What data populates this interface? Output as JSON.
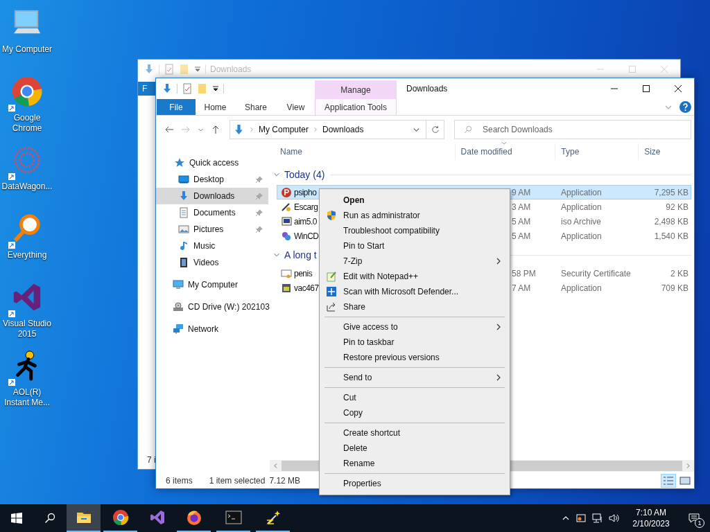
{
  "desktop_icons": [
    {
      "label": "My Computer",
      "shortcut": false
    },
    {
      "label": "Google Chrome",
      "shortcut": true
    },
    {
      "label": "DataWagon...",
      "shortcut": true
    },
    {
      "label": "Everything",
      "shortcut": true
    },
    {
      "label": "Visual Studio 2015",
      "shortcut": true
    },
    {
      "label": "AOL(R) Instant Me...",
      "shortcut": true
    }
  ],
  "back_window": {
    "title": "Downloads",
    "file_tab": "F",
    "status": "7 i"
  },
  "window": {
    "title": "Downloads",
    "context_tab": "Manage",
    "tabs": [
      {
        "label": "File",
        "kind": "file"
      },
      {
        "label": "Home",
        "kind": "tab"
      },
      {
        "label": "Share",
        "kind": "tab"
      },
      {
        "label": "View",
        "kind": "tab"
      },
      {
        "label": "Application Tools",
        "kind": "context"
      }
    ],
    "address": [
      "My Computer",
      "Downloads"
    ],
    "search": {
      "placeholder": "Search Downloads"
    },
    "nav": [
      {
        "label": "Quick access",
        "selected": false,
        "pinned": false,
        "children": [
          {
            "label": "Desktop",
            "selected": false,
            "pinned": true
          },
          {
            "label": "Downloads",
            "selected": true,
            "pinned": true
          },
          {
            "label": "Documents",
            "selected": false,
            "pinned": true
          },
          {
            "label": "Pictures",
            "selected": false,
            "pinned": true
          },
          {
            "label": "Music",
            "selected": false,
            "pinned": false
          },
          {
            "label": "Videos",
            "selected": false,
            "pinned": false
          }
        ]
      },
      {
        "label": "My Computer",
        "selected": false,
        "pinned": false
      },
      {
        "label": "CD Drive (W:) 202103",
        "selected": false,
        "pinned": false
      },
      {
        "label": "Network",
        "selected": false,
        "pinned": false
      }
    ],
    "columns": [
      {
        "label": "Name",
        "sorted": false
      },
      {
        "label": "Date modified",
        "sorted": true
      },
      {
        "label": "Type",
        "sorted": false
      },
      {
        "label": "Size",
        "sorted": false
      }
    ],
    "groups": [
      {
        "title": "Today (4)",
        "rows": [
          {
            "name": "psipho",
            "date": "9 AM",
            "type": "Application",
            "size": "7,295 KB",
            "selected": true
          },
          {
            "name": "Escarg",
            "date": "3 AM",
            "type": "Application",
            "size": "92 KB",
            "selected": false
          },
          {
            "name": "aim5.0",
            "date": "5 AM",
            "type": "iso Archive",
            "size": "2,498 KB",
            "selected": false
          },
          {
            "name": "WinCD",
            "date": "5 AM",
            "type": "Application",
            "size": "1,540 KB",
            "selected": false
          }
        ]
      },
      {
        "title": "A long t",
        "rows": [
          {
            "name": "penis",
            "date": "58 PM",
            "type": "Security Certificate",
            "size": "2 KB",
            "selected": false
          },
          {
            "name": "vac467",
            "date": "7 AM",
            "type": "Application",
            "size": "709 KB",
            "selected": false
          }
        ]
      }
    ],
    "status": {
      "items": "6 items",
      "selection": "1 item selected",
      "size": "7.12 MB"
    },
    "views": [
      {
        "kind": "details",
        "selected": true
      },
      {
        "kind": "large",
        "selected": false
      }
    ]
  },
  "context_menu": [
    {
      "kind": "item",
      "label": "Open",
      "default": true,
      "submenu": false
    },
    {
      "kind": "item",
      "label": "Run as administrator",
      "default": false,
      "submenu": false
    },
    {
      "kind": "item",
      "label": "Troubleshoot compatibility",
      "default": false,
      "submenu": false
    },
    {
      "kind": "item",
      "label": "Pin to Start",
      "default": false,
      "submenu": false
    },
    {
      "kind": "item",
      "label": "7-Zip",
      "default": false,
      "submenu": true
    },
    {
      "kind": "item",
      "label": "Edit with Notepad++",
      "default": false,
      "submenu": false
    },
    {
      "kind": "item",
      "label": "Scan with Microsoft Defender...",
      "default": false,
      "submenu": false
    },
    {
      "kind": "item",
      "label": "Share",
      "default": false,
      "submenu": false
    },
    {
      "kind": "separator"
    },
    {
      "kind": "item",
      "label": "Give access to",
      "default": false,
      "submenu": true
    },
    {
      "kind": "item",
      "label": "Pin to taskbar",
      "default": false,
      "submenu": false
    },
    {
      "kind": "item",
      "label": "Restore previous versions",
      "default": false,
      "submenu": false
    },
    {
      "kind": "separator"
    },
    {
      "kind": "item",
      "label": "Send to",
      "default": false,
      "submenu": true
    },
    {
      "kind": "separator"
    },
    {
      "kind": "item",
      "label": "Cut",
      "default": false,
      "submenu": false
    },
    {
      "kind": "item",
      "label": "Copy",
      "default": false,
      "submenu": false
    },
    {
      "kind": "separator"
    },
    {
      "kind": "item",
      "label": "Create shortcut",
      "default": false,
      "submenu": false
    },
    {
      "kind": "item",
      "label": "Delete",
      "default": false,
      "submenu": false
    },
    {
      "kind": "item",
      "label": "Rename",
      "default": false,
      "submenu": false
    },
    {
      "kind": "separator"
    },
    {
      "kind": "item",
      "label": "Properties",
      "default": false,
      "submenu": false
    }
  ],
  "taskbar": {
    "apps": [
      {
        "active": true,
        "running": true
      },
      {
        "active": false,
        "running": true
      },
      {
        "active": false,
        "running": false
      },
      {
        "active": false,
        "running": true
      },
      {
        "active": false,
        "running": true
      },
      {
        "active": false,
        "running": true
      }
    ],
    "time": "7:10 AM",
    "date": "2/10/2023",
    "notifications": "1"
  }
}
